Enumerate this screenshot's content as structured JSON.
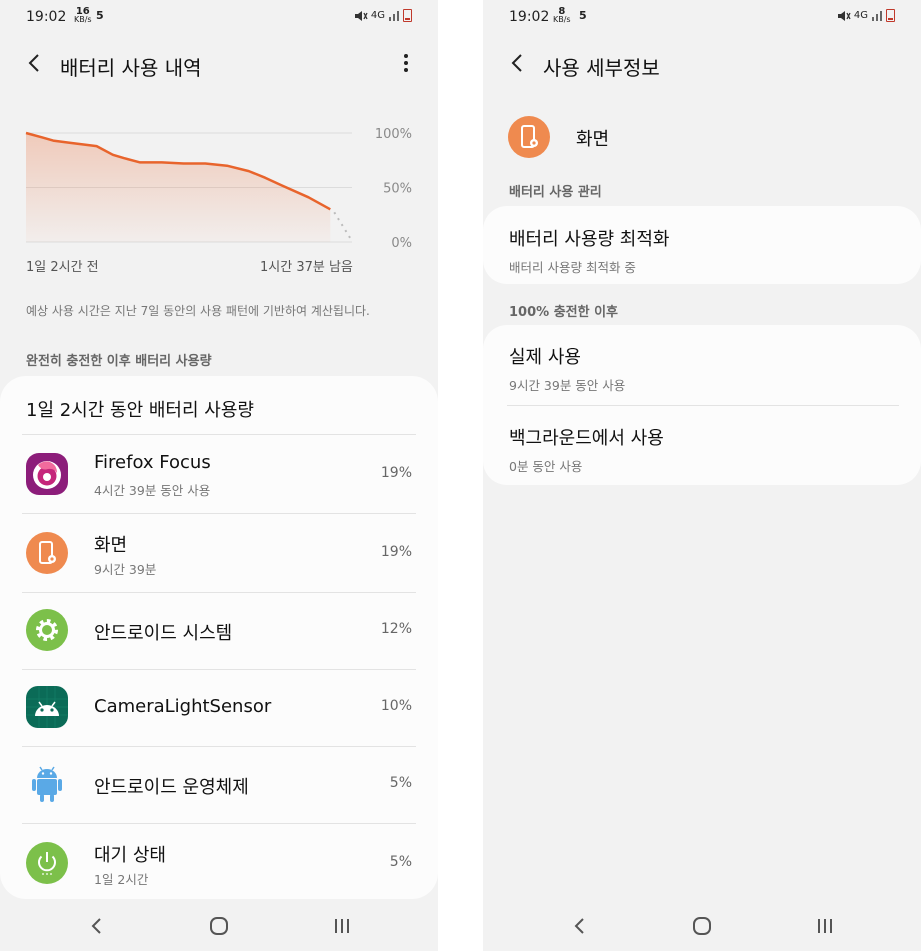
{
  "left": {
    "status": {
      "time": "19:02",
      "speed_value": "16",
      "speed_unit": "KB/s",
      "notif": "5",
      "net": "4G"
    },
    "title": "배터리 사용 내역",
    "chart_data": {
      "type": "area",
      "x": [
        0,
        3,
        5,
        8,
        13,
        16,
        18,
        21,
        25,
        29,
        33,
        37,
        41,
        44,
        47,
        52,
        56
      ],
      "values": [
        100,
        96,
        93,
        91,
        88,
        80,
        77,
        73,
        73,
        72,
        72,
        70,
        65,
        59,
        52,
        41,
        30
      ],
      "y_ticks": [
        "100%",
        "50%",
        "0%"
      ],
      "ylim": [
        0,
        100
      ],
      "x_labels": [
        "1일 2시간 전",
        "1시간 37분 남음"
      ],
      "line_color": "#e8642c",
      "grid": true
    },
    "note": "예상 사용 시간은 지난 7일 동안의 사용 패턴에 기반하여 계산됩니다.",
    "section_label": "완전히 충전한 이후 배터리 사용량",
    "card_title": "1일 2시간 동안 배터리 사용량",
    "apps": [
      {
        "name": "Firefox Focus",
        "sub": "4시간 39분 동안 사용",
        "pct": "19%",
        "icon": "firefox-focus-icon"
      },
      {
        "name": "화면",
        "sub": "9시간 39분",
        "pct": "19%",
        "icon": "screen-icon"
      },
      {
        "name": "안드로이드 시스템",
        "sub": "",
        "pct": "12%",
        "icon": "android-system-icon"
      },
      {
        "name": "CameraLightSensor",
        "sub": "",
        "pct": "10%",
        "icon": "android-app-icon"
      },
      {
        "name": "안드로이드 운영체제",
        "sub": "",
        "pct": "5%",
        "icon": "android-os-icon"
      },
      {
        "name": "대기 상태",
        "sub": "1일 2시간",
        "pct": "5%",
        "icon": "standby-icon"
      }
    ]
  },
  "right": {
    "status": {
      "time": "19:02",
      "speed_value": "8",
      "speed_unit": "KB/s",
      "notif": "5",
      "net": "4G"
    },
    "title": "사용 세부정보",
    "app_name": "화면",
    "section1": "배터리 사용 관리",
    "opt_title": "배터리 사용량 최적화",
    "opt_sub": "배터리 사용량 최적화 중",
    "section2": "100% 충전한 이후",
    "actual_title": "실제 사용",
    "actual_sub": "9시간 39분 동안 사용",
    "bg_title": "백그라운드에서 사용",
    "bg_sub": "0분 동안 사용"
  },
  "colors": {
    "accent": "#e8642c",
    "screen_orange": "#ef8a4f",
    "system_green": "#7cc04a"
  }
}
